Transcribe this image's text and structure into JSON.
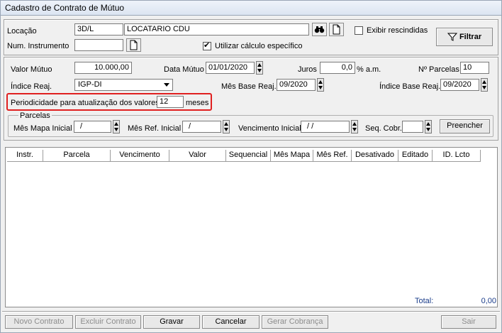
{
  "window": {
    "title": "Cadastro de Contrato de Mútuo"
  },
  "top": {
    "locacao_label": "Locação",
    "locacao_code": "3D/L",
    "locacao_name": "LOCATARIO CDU",
    "num_instrumento_label": "Num. Instrumento",
    "num_instrumento_value": "",
    "exibir_rescindidas_label": "Exibir rescindidas",
    "exibir_rescindidas_checked": false,
    "utilizar_calculo_label": "Utilizar cálculo específico",
    "utilizar_calculo_checked": true,
    "filtrar_label": "Filtrar",
    "check_mark": "✔"
  },
  "mid": {
    "valor_mutuo_label": "Valor Mútuo",
    "valor_mutuo_value": "10.000,00",
    "data_mutuo_label": "Data Mútuo",
    "data_mutuo_value": "01/01/2020",
    "juros_label": "Juros",
    "juros_value": "0,0",
    "juros_unit": "% a.m.",
    "parcelas_label": "Nº Parcelas",
    "parcelas_value": "10",
    "indice_reaj_label": "Índice Reaj.",
    "indice_reaj_value": "IGP-DI",
    "mes_base_label": "Mês Base Reaj.",
    "mes_base_value": "09/2020",
    "indice_base_label": "Índice Base Reaj.",
    "indice_base_value": "09/2020",
    "periodicidade_label": "Periodicidade para atualização dos valores",
    "periodicidade_value": "12",
    "periodicidade_unit": "meses"
  },
  "parcelas_group": {
    "legend": "Parcelas",
    "mes_mapa_label": "Mês Mapa Inicial",
    "mes_mapa_value": "/",
    "mes_ref_label": "Mês Ref. Inicial",
    "mes_ref_value": "/",
    "vencimento_label": "Vencimento Inicial",
    "vencimento_value": "/ /",
    "seq_cobr_label": "Seq. Cobr.",
    "seq_cobr_value": "",
    "preencher_label": "Preencher"
  },
  "grid": {
    "columns": [
      "Instr.",
      "Parcela",
      "Vencimento",
      "Valor",
      "Sequencial",
      "Mês Mapa",
      "Mês Ref.",
      "Desativado",
      "Editado",
      "ID. Lcto"
    ],
    "total_label": "Total:",
    "total_value": "0,00"
  },
  "footer": {
    "novo_label": "Novo Contrato",
    "excluir_label": "Excluir Contrato",
    "gravar_label": "Gravar",
    "cancelar_label": "Cancelar",
    "gerar_label": "Gerar Cobrança",
    "sair_label": "Sair"
  }
}
